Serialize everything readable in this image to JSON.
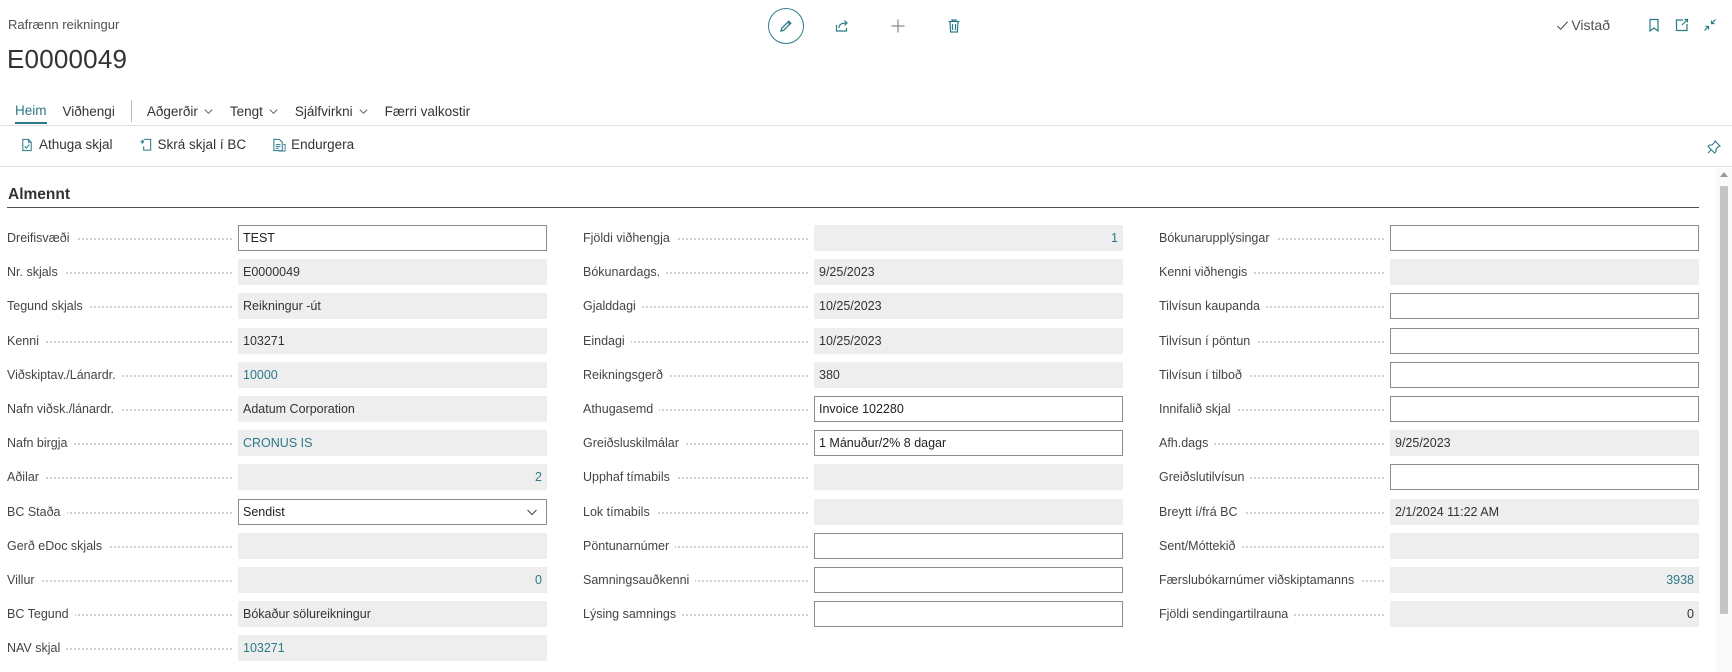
{
  "header": {
    "caption": "Rafrænn reikningur",
    "title": "E0000049",
    "saved_label": "Vistað"
  },
  "nav": {
    "items": [
      {
        "label": "Heim",
        "active": true,
        "dropdown": false
      },
      {
        "label": "Viðhengi",
        "active": false,
        "dropdown": false
      },
      {
        "label": "Aðgerðir",
        "active": false,
        "dropdown": true
      },
      {
        "label": "Tengt",
        "active": false,
        "dropdown": true
      },
      {
        "label": "Sjálfvirkni",
        "active": false,
        "dropdown": true
      },
      {
        "label": "Færri valkostir",
        "active": false,
        "dropdown": false
      }
    ]
  },
  "actions": {
    "items": [
      {
        "label": "Athuga skjal",
        "icon": "check-document-icon"
      },
      {
        "label": "Skrá skjal í BC",
        "icon": "register-document-icon"
      },
      {
        "label": "Endurgera",
        "icon": "regenerate-icon"
      }
    ]
  },
  "section": {
    "title": "Almennt"
  },
  "columns": [
    [
      {
        "label": "Dreifisvæði",
        "value": "TEST",
        "type": "edit"
      },
      {
        "label": "Nr. skjals",
        "value": "E0000049",
        "type": "ro"
      },
      {
        "label": "Tegund skjals",
        "value": "Reikningur -út",
        "type": "ro"
      },
      {
        "label": "Kenni",
        "value": "103271",
        "type": "ro"
      },
      {
        "label": "Viðskiptav./Lánardr.",
        "value": "10000",
        "type": "ro-link"
      },
      {
        "label": "Nafn viðsk./lánardr.",
        "value": "Adatum Corporation",
        "type": "ro"
      },
      {
        "label": "Nafn birgja",
        "value": "CRONUS IS",
        "type": "ro-link"
      },
      {
        "label": "Aðilar",
        "value": "2",
        "type": "ro-num-link"
      },
      {
        "label": "BC Staða",
        "value": "Sendist",
        "type": "select"
      },
      {
        "label": "Gerð eDoc skjals",
        "value": "",
        "type": "ro"
      },
      {
        "label": "Villur",
        "value": "0",
        "type": "ro-num-link"
      },
      {
        "label": "BC Tegund",
        "value": "Bókaður sölureikningur",
        "type": "ro"
      },
      {
        "label": "NAV skjal",
        "value": "103271",
        "type": "ro-link"
      }
    ],
    [
      {
        "label": "Fjöldi viðhengja",
        "value": "1",
        "type": "ro-num-link"
      },
      {
        "label": "Bókunardags.",
        "value": "9/25/2023",
        "type": "ro"
      },
      {
        "label": "Gjalddagi",
        "value": "10/25/2023",
        "type": "ro"
      },
      {
        "label": "Eindagi",
        "value": "10/25/2023",
        "type": "ro"
      },
      {
        "label": "Reikningsgerð",
        "value": "380",
        "type": "ro"
      },
      {
        "label": "Athugasemd",
        "value": "Invoice 102280",
        "type": "edit"
      },
      {
        "label": "Greiðsluskilmálar",
        "value": "1 Mánuður/2% 8 dagar",
        "type": "edit"
      },
      {
        "label": "Upphaf tímabils",
        "value": "",
        "type": "ro"
      },
      {
        "label": "Lok tímabils",
        "value": "",
        "type": "ro"
      },
      {
        "label": "Pöntunarnúmer",
        "value": "",
        "type": "edit"
      },
      {
        "label": "Samningsauðkenni",
        "value": "",
        "type": "edit"
      },
      {
        "label": "Lýsing samnings",
        "value": "",
        "type": "edit"
      }
    ],
    [
      {
        "label": "Bókunarupplýsingar",
        "value": "",
        "type": "edit"
      },
      {
        "label": "Kenni viðhengis",
        "value": "",
        "type": "ro"
      },
      {
        "label": "Tilvísun kaupanda",
        "value": "",
        "type": "edit"
      },
      {
        "label": "Tilvísun í pöntun",
        "value": "",
        "type": "edit"
      },
      {
        "label": "Tilvísun í tilboð",
        "value": "",
        "type": "edit"
      },
      {
        "label": "Innifalið skjal",
        "value": "",
        "type": "edit"
      },
      {
        "label": "Afh.dags",
        "value": "9/25/2023",
        "type": "ro"
      },
      {
        "label": "Greiðslutilvísun",
        "value": "",
        "type": "edit"
      },
      {
        "label": "Breytt í/frá BC",
        "value": "2/1/2024 11:22 AM",
        "type": "ro"
      },
      {
        "label": "Sent/Móttekið",
        "value": "",
        "type": "ro"
      },
      {
        "label": "Færslubókarnúmer viðskiptamanns",
        "value": "3938",
        "type": "ro-num-link"
      },
      {
        "label": "Fjöldi sendingartilrauna",
        "value": "0",
        "type": "ro-num"
      }
    ]
  ],
  "colors": {
    "accent": "#2b7a87",
    "readonly_bg": "#eeeeee",
    "edit_border": "#8c8c8c"
  }
}
